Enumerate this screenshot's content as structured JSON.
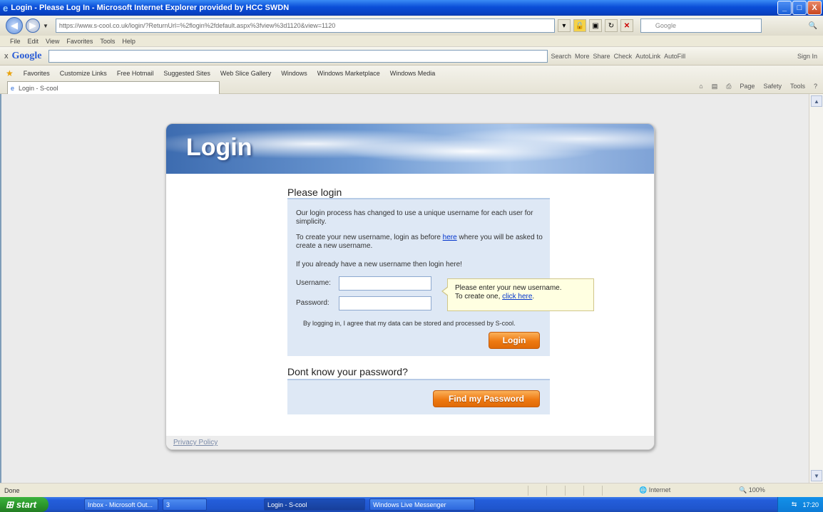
{
  "window": {
    "title": "Login - Please Log In - Microsoft Internet Explorer provided by HCC SWDN",
    "btn_min": "_",
    "btn_max": "□",
    "btn_close": "X"
  },
  "addressbar": {
    "url": "https://www.s-cool.co.uk/login/?ReturnUrl=%2flogin%2fdefault.aspx%3fview%3d1120&view=1120",
    "search_placeholder": "Google"
  },
  "menu": [
    "File",
    "Edit",
    "View",
    "Favorites",
    "Tools",
    "Help"
  ],
  "google_toolbar": {
    "close": "x",
    "logo": "Google",
    "search": "Search",
    "tools": [
      "More",
      "Share",
      "Check",
      "AutoLink",
      "AutoFill"
    ],
    "signin": "Sign In"
  },
  "favorites": {
    "label": "Favorites",
    "items": [
      "Customize Links",
      "Free Hotmail",
      "Suggested Sites",
      "Web Slice Gallery",
      "Windows",
      "Windows Marketplace",
      "Windows Media"
    ]
  },
  "tab": {
    "label": "Login - S-cool"
  },
  "commandbar": [
    "Page",
    "Safety",
    "Tools"
  ],
  "login": {
    "banner_title": "Login",
    "please_login": "Please login",
    "intro1": "Our login process has changed to use a unique username for each user for simplicity.",
    "intro2_before": "To create your new username, login as before ",
    "intro2_link": "here",
    "intro2_after": " where you will be asked to create a new username.",
    "intro3": "If you already have a new username then login here!",
    "username_label": "Username:",
    "password_label": "Password:",
    "consent": "By logging in, I agree that my data can be stored and processed by S-cool.",
    "login_button": "Login",
    "tooltip_line1": "Please enter your new username.",
    "tooltip_line2_before": "To create one, ",
    "tooltip_link": "click here",
    "tooltip_line2_after": ".",
    "forgot_title": "Dont know your password?",
    "find_button": "Find my Password",
    "privacy": "Privacy Policy"
  },
  "status": {
    "left": "Done",
    "zone": "Internet",
    "zoom": "100%"
  },
  "taskbar": {
    "start": "start",
    "tasks": [
      "Inbox - Microsoft Out...",
      "3",
      "Login - S-cool",
      "Windows Live Messenger"
    ],
    "clock": "17:20"
  }
}
